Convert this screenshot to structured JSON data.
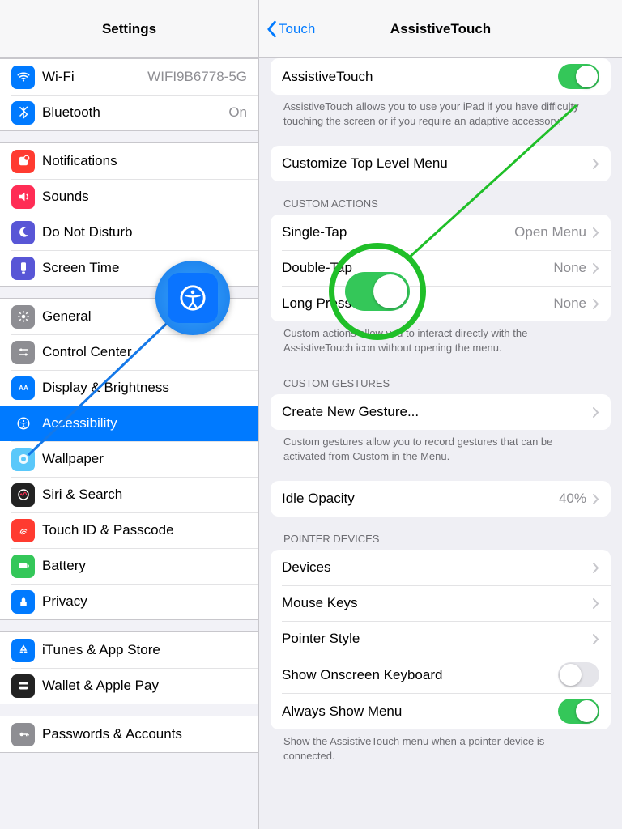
{
  "left": {
    "title": "Settings",
    "groups": [
      {
        "items": [
          {
            "icon": "wifi",
            "bg": "bg-blue",
            "label": "Wi-Fi",
            "value": "WIFI9B6778-5G"
          },
          {
            "icon": "bluetooth",
            "bg": "bg-blue",
            "label": "Bluetooth",
            "value": "On"
          }
        ]
      },
      {
        "items": [
          {
            "icon": "notifications",
            "bg": "bg-red",
            "label": "Notifications"
          },
          {
            "icon": "sounds",
            "bg": "bg-pink",
            "label": "Sounds"
          },
          {
            "icon": "dnd",
            "bg": "bg-purple",
            "label": "Do Not Disturb"
          },
          {
            "icon": "screentime",
            "bg": "bg-purple",
            "label": "Screen Time"
          }
        ]
      },
      {
        "items": [
          {
            "icon": "general",
            "bg": "bg-grey",
            "label": "General"
          },
          {
            "icon": "controlcenter",
            "bg": "bg-grey",
            "label": "Control Center"
          },
          {
            "icon": "displaybrightness",
            "bg": "bg-blue",
            "label": "Display & Brightness"
          },
          {
            "icon": "accessibility",
            "bg": "bg-blue",
            "label": "Accessibility",
            "selected": true
          },
          {
            "icon": "wallpaper",
            "bg": "bg-teal",
            "label": "Wallpaper"
          },
          {
            "icon": "siri",
            "bg": "bg-black",
            "label": "Siri & Search"
          },
          {
            "icon": "touchid",
            "bg": "bg-red",
            "label": "Touch ID & Passcode"
          },
          {
            "icon": "battery",
            "bg": "bg-green",
            "label": "Battery"
          },
          {
            "icon": "privacy",
            "bg": "bg-blue",
            "label": "Privacy"
          }
        ]
      },
      {
        "items": [
          {
            "icon": "appstore",
            "bg": "bg-blue",
            "label": "iTunes & App Store"
          },
          {
            "icon": "wallet",
            "bg": "bg-black",
            "label": "Wallet & Apple Pay"
          }
        ]
      },
      {
        "items": [
          {
            "icon": "passwords",
            "bg": "bg-grey",
            "label": "Passwords & Accounts"
          }
        ]
      }
    ]
  },
  "right": {
    "back_label": "Touch",
    "title": "AssistiveTouch",
    "groups": [
      {
        "items": [
          {
            "label": "AssistiveTouch",
            "type": "toggle",
            "on": true
          }
        ],
        "footer": "AssistiveTouch allows you to use your iPad if you have difficulty touching the screen or if you require an adaptive accessory."
      },
      {
        "items": [
          {
            "label": "Customize Top Level Menu",
            "type": "nav"
          }
        ]
      },
      {
        "header": "CUSTOM ACTIONS",
        "items": [
          {
            "label": "Single-Tap",
            "type": "nav",
            "value": "Open Menu"
          },
          {
            "label": "Double-Tap",
            "type": "nav",
            "value": "None"
          },
          {
            "label": "Long Press",
            "type": "nav",
            "value": "None"
          }
        ],
        "footer": "Custom actions allow you to interact directly with the AssistiveTouch icon without opening the menu."
      },
      {
        "header": "CUSTOM GESTURES",
        "items": [
          {
            "label": "Create New Gesture...",
            "type": "nav"
          }
        ],
        "footer": "Custom gestures allow you to record gestures that can be activated from Custom in the Menu."
      },
      {
        "items": [
          {
            "label": "Idle Opacity",
            "type": "nav",
            "value": "40%"
          }
        ]
      },
      {
        "header": "POINTER DEVICES",
        "items": [
          {
            "label": "Devices",
            "type": "nav"
          },
          {
            "label": "Mouse Keys",
            "type": "nav"
          },
          {
            "label": "Pointer Style",
            "type": "nav"
          },
          {
            "label": "Show Onscreen Keyboard",
            "type": "toggle",
            "on": false
          },
          {
            "label": "Always Show Menu",
            "type": "toggle",
            "on": true
          }
        ],
        "footer": "Show the AssistiveTouch menu when a pointer device is connected."
      }
    ]
  }
}
